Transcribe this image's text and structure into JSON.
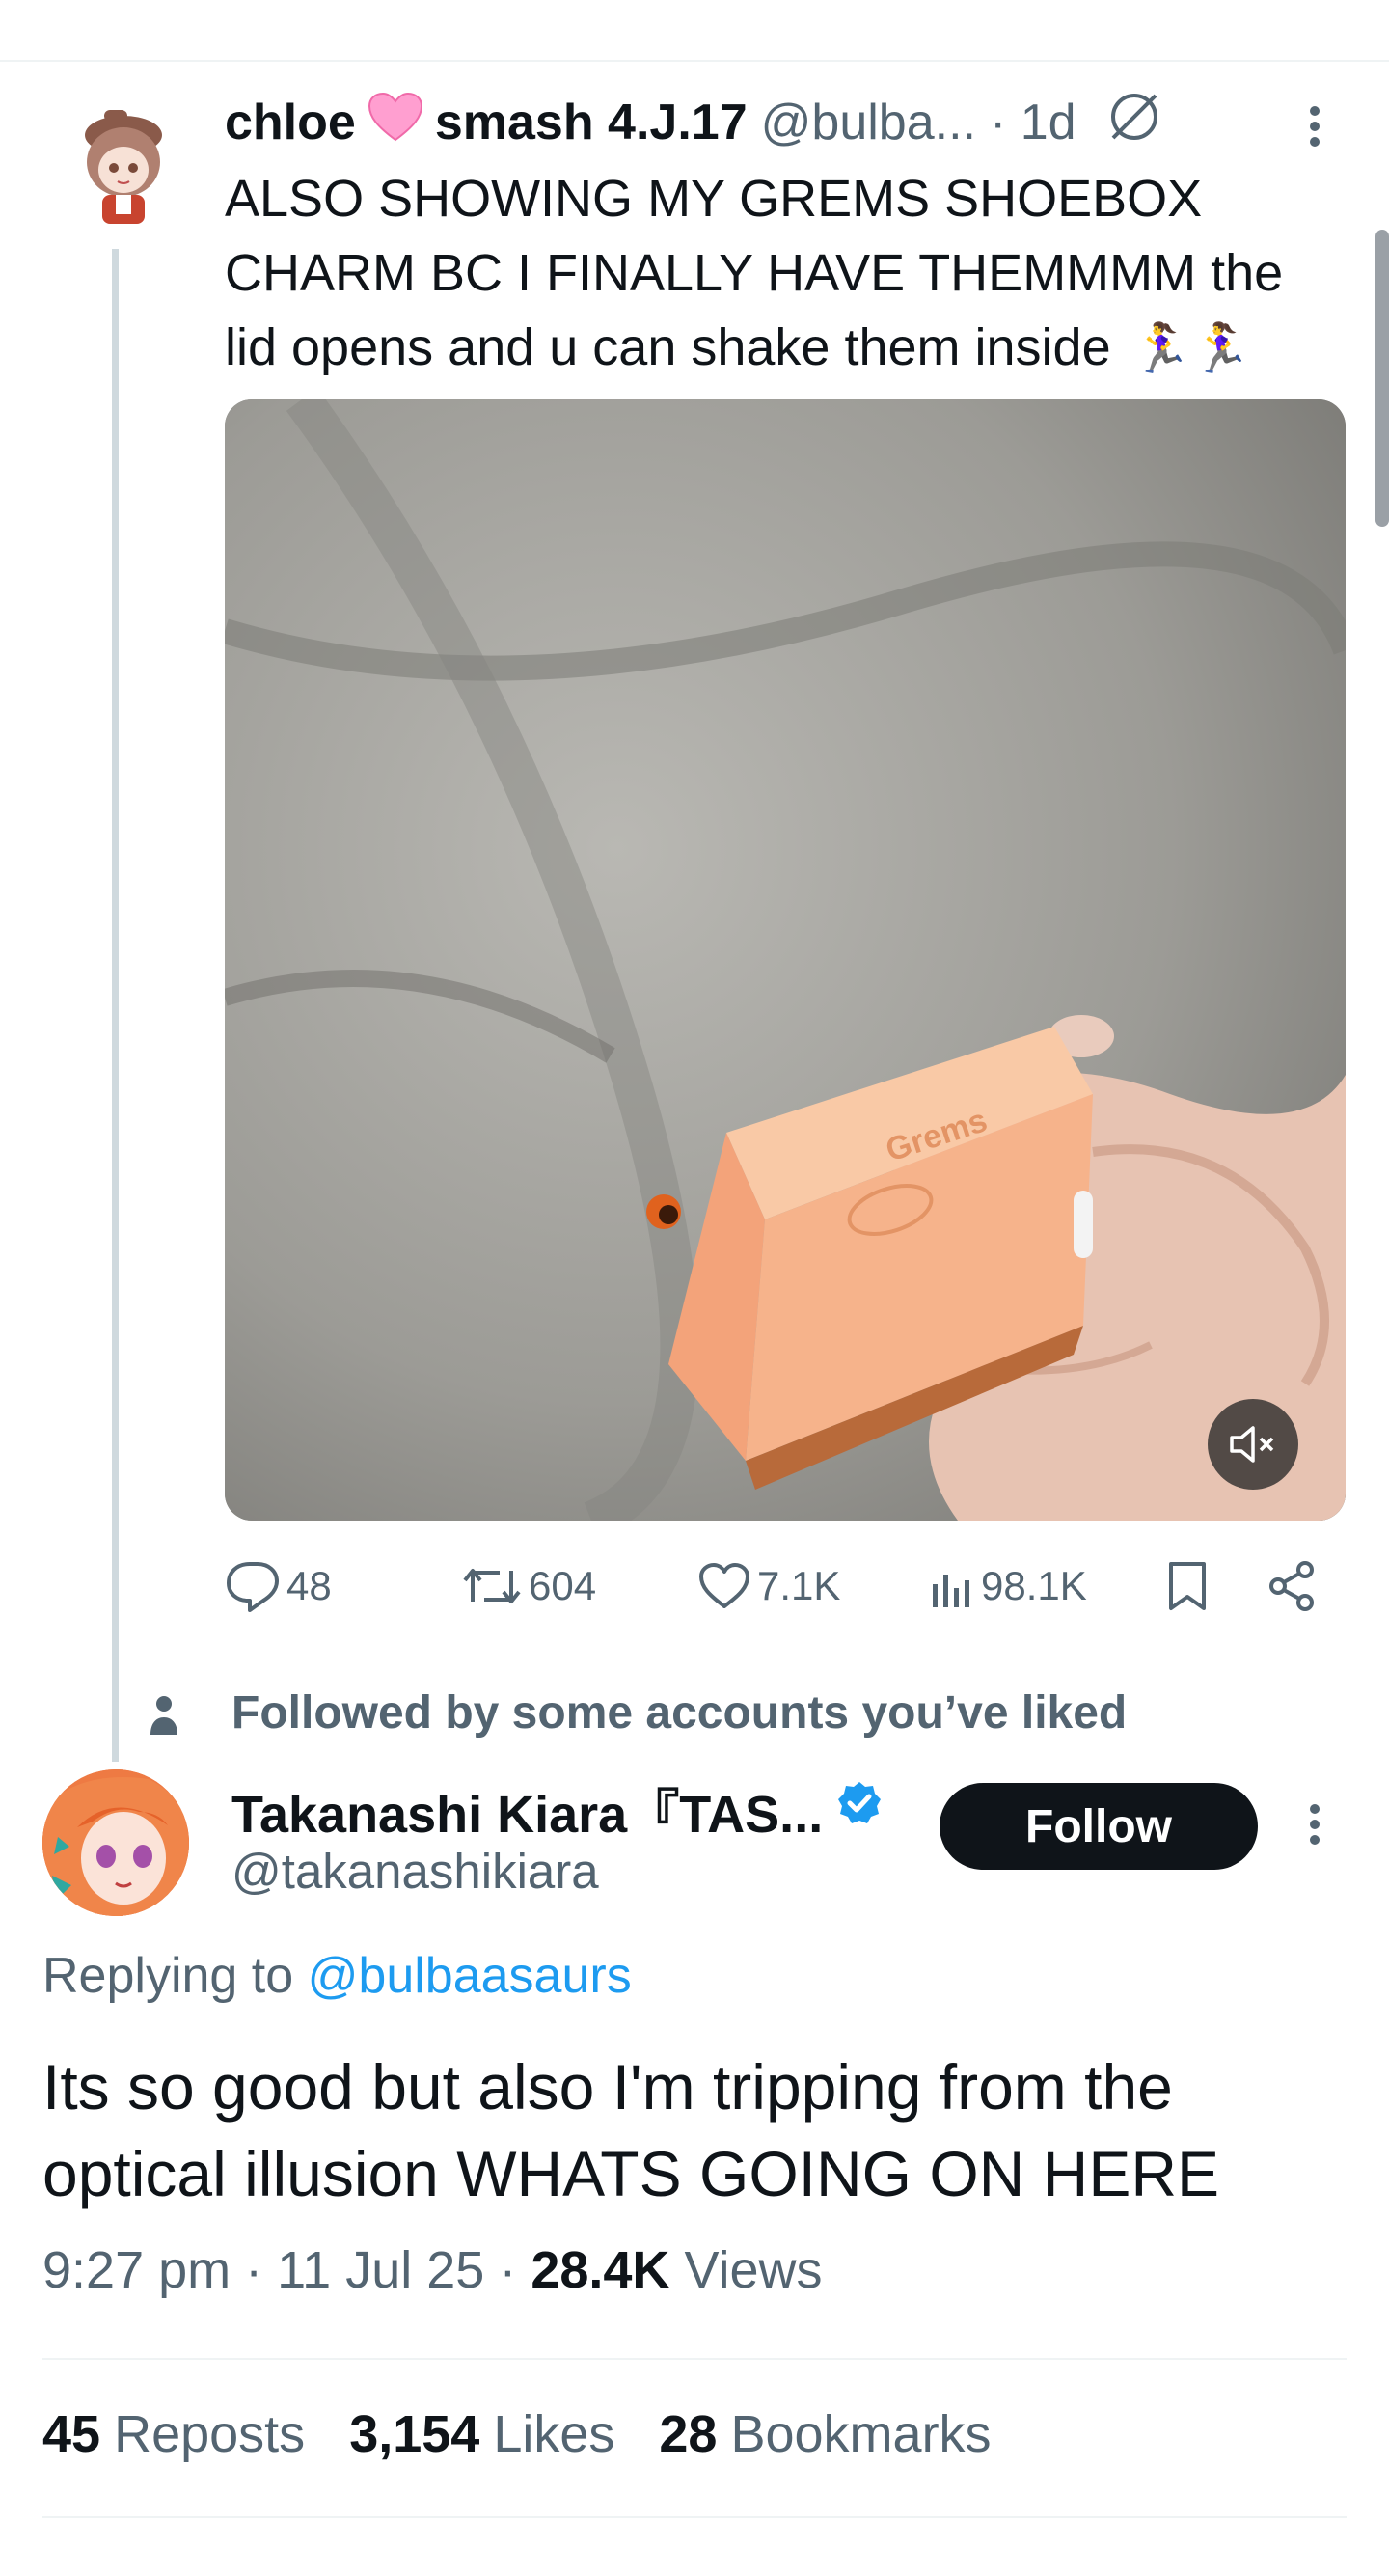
{
  "tweet1": {
    "display_name": "chloe",
    "name_suffix": "smash 4.J.17",
    "handle": "@bulba...",
    "time": "· 1d",
    "text": "ALSO SHOWING MY GREMS SHOEBOX CHARM BC I FINALLY HAVE THEMMMM the lid opens and u can shake them inside",
    "emoji": "🏃‍♀️🏃‍♀️",
    "box_print": "Grems",
    "actions": {
      "replies": "48",
      "reposts": "604",
      "likes": "7.1K",
      "views": "98.1K"
    }
  },
  "social_context": "Followed by some accounts you’ve liked",
  "tweet2": {
    "display_name": "Takanashi Kiara『TAS...",
    "handle": "@takanashikiara",
    "follow_label": "Follow",
    "replying_prefix": "Replying to",
    "replying_handle": "@bulbaasaurs",
    "text": "Its so good but also I'm tripping from the optical illusion WHATS GOING ON HERE",
    "time": "9:27 pm",
    "date": "11 Jul 25",
    "views_count": "28.4K",
    "views_label": "Views",
    "stats": {
      "reposts_count": "45",
      "reposts_label": "Reposts",
      "likes_count": "3,154",
      "likes_label": "Likes",
      "bookmarks_count": "28",
      "bookmarks_label": "Bookmarks"
    }
  },
  "colors": {
    "accent": "#1d9bf0",
    "text": "#0f1419",
    "muted": "#536471",
    "heart_emoji": "#ff8fc7",
    "box": "#f2a87a"
  },
  "icons": [
    "reply-icon",
    "repost-icon",
    "like-icon",
    "views-icon",
    "bookmark-icon",
    "share-icon",
    "mute-icon",
    "verified-badge-icon",
    "person-icon",
    "more-icon",
    "unlisted-icon"
  ]
}
